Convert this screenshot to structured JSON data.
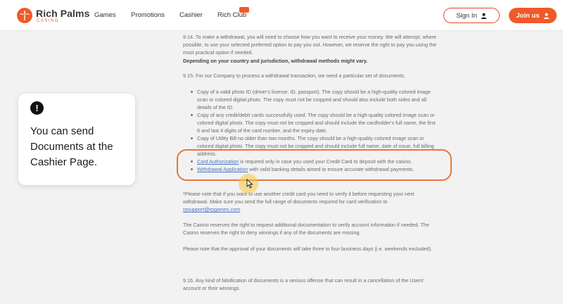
{
  "header": {
    "brand": "Rich Palms",
    "brand_sub": "CASINO",
    "nav": [
      "Games",
      "Promotions",
      "Cashier",
      "Rich Club"
    ],
    "signin_label": "Sign In",
    "join_label": "Join us",
    "accent_color": "#f05a28"
  },
  "document": {
    "p914_a": "9.14. To make a withdrawal, you will need to choose how you want to receive your money. We will attempt, where possible, to use your selected preferred option to pay you out. However, we reserve the right to pay you using the most practical option if needed.",
    "p914_b": "Depending on your country and jurisdiction, withdrawal methods might vary.",
    "p915": "9.15. For our Company to process a withdrawal transaction, we need a particular set of documents:",
    "b1": "Copy of a valid photo ID (driver's license, ID, passport). The copy should be a high-quality colored image scan or colored digital photo. The copy must not be cropped and should also include both sides and all details of the ID.",
    "b2": "Copy of any credit/debit cards successfully used. The copy should be a high-quality colored image scan or colored digital photo. The copy must not be cropped and should include the cardholder's full name, the first 6 and last 4 digits of the card number, and the expiry date.",
    "b3": "Copy of Utility Bill no older than two months. The copy should be a high-quality colored image scan or colored digital photo. The copy must not be cropped and should include full name, date of issue, full billing address.",
    "b4_link": "Card Authorization",
    "b4_rest": " is required only in case you used your Credit Card to deposit with the casino.",
    "b5_link": "Withdrawal Application",
    "b5_rest": " with valid banking details aimed to ensure accurate withdrawal payments.",
    "note": "*Please note that if you want to use another credit card you need to verify it before requesting your next withdrawal. Make sure you send the full range of documents required for card verification to",
    "note_email": "rpsupport@rpgames.com",
    "reserve": "The Casino reserves the right to request additional documentation to verify account information if needed. The Casino reserves the right to deny winnings if any of the documents are missing.",
    "approval": "Please note that the approval of your documents will take three to four business days (i.e. weekends excluded).",
    "p916": "9.16. Any kind of falsification of documents is a serious offense that can result in a cancellation of the Users' account or their winnings."
  },
  "card": {
    "icon": "!",
    "text": "You can send Documents at the Cashier Page."
  }
}
